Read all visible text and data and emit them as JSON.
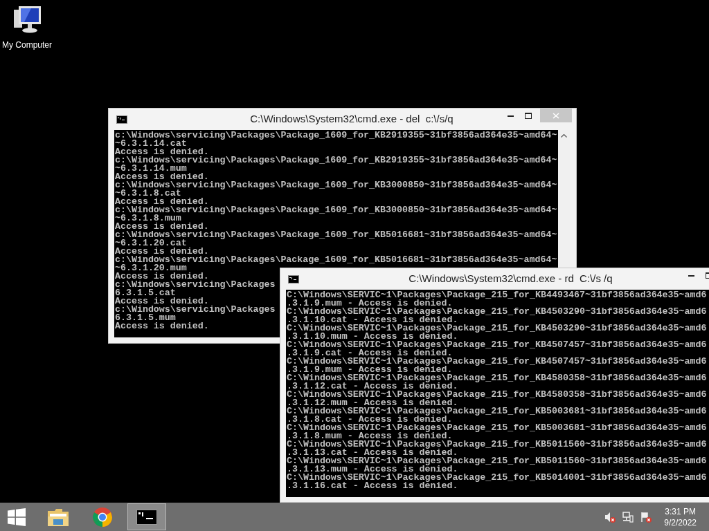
{
  "desktop_icons": [
    {
      "label": "My Computer"
    }
  ],
  "windows": [
    {
      "title": "C:\\Windows\\System32\\cmd.exe - del  c:\\/s/q",
      "controls": [
        {
          "kind": "minimize"
        },
        {
          "kind": "maximize"
        },
        {
          "kind": "close"
        }
      ],
      "scrollbar": true,
      "lines": [
        "c:\\Windows\\servicing\\Packages\\Package_1609_for_KB2919355~31bf3856ad364e35~amd64~",
        "~6.3.1.14.cat",
        "Access is denied.",
        "c:\\Windows\\servicing\\Packages\\Package_1609_for_KB2919355~31bf3856ad364e35~amd64~",
        "~6.3.1.14.mum",
        "Access is denied.",
        "c:\\Windows\\servicing\\Packages\\Package_1609_for_KB3000850~31bf3856ad364e35~amd64~",
        "~6.3.1.8.cat",
        "Access is denied.",
        "c:\\Windows\\servicing\\Packages\\Package_1609_for_KB3000850~31bf3856ad364e35~amd64~",
        "~6.3.1.8.mum",
        "Access is denied.",
        "c:\\Windows\\servicing\\Packages\\Package_1609_for_KB5016681~31bf3856ad364e35~amd64~",
        "~6.3.1.20.cat",
        "Access is denied.",
        "c:\\Windows\\servicing\\Packages\\Package_1609_for_KB5016681~31bf3856ad364e35~amd64~",
        "~6.3.1.20.mum",
        "Access is denied.",
        "c:\\Windows\\servicing\\Packages",
        "6.3.1.5.cat",
        "Access is denied.",
        "c:\\Windows\\servicing\\Packages",
        "6.3.1.5.mum",
        "Access is denied."
      ]
    },
    {
      "title": "C:\\Windows\\System32\\cmd.exe - rd  C:\\/s /q",
      "controls": [
        {
          "kind": "minimize"
        },
        {
          "kind": "maximize"
        }
      ],
      "scrollbar": false,
      "lines": [
        "C:\\Windows\\SERVIC~1\\Packages\\Package_215_for_KB4493467~31bf3856ad364e35~amd6",
        ".3.1.9.mum - Access is denied.",
        "C:\\Windows\\SERVIC~1\\Packages\\Package_215_for_KB4503290~31bf3856ad364e35~amd6",
        ".3.1.10.cat - Access is denied.",
        "C:\\Windows\\SERVIC~1\\Packages\\Package_215_for_KB4503290~31bf3856ad364e35~amd6",
        ".3.1.10.mum - Access is denied.",
        "C:\\Windows\\SERVIC~1\\Packages\\Package_215_for_KB4507457~31bf3856ad364e35~amd6",
        ".3.1.9.cat - Access is denied.",
        "C:\\Windows\\SERVIC~1\\Packages\\Package_215_for_KB4507457~31bf3856ad364e35~amd6",
        ".3.1.9.mum - Access is denied.",
        "C:\\Windows\\SERVIC~1\\Packages\\Package_215_for_KB4580358~31bf3856ad364e35~amd6",
        ".3.1.12.cat - Access is denied.",
        "C:\\Windows\\SERVIC~1\\Packages\\Package_215_for_KB4580358~31bf3856ad364e35~amd6",
        ".3.1.12.mum - Access is denied.",
        "C:\\Windows\\SERVIC~1\\Packages\\Package_215_for_KB5003681~31bf3856ad364e35~amd6",
        ".3.1.8.cat - Access is denied.",
        "C:\\Windows\\SERVIC~1\\Packages\\Package_215_for_KB5003681~31bf3856ad364e35~amd6",
        ".3.1.8.mum - Access is denied.",
        "C:\\Windows\\SERVIC~1\\Packages\\Package_215_for_KB5011560~31bf3856ad364e35~amd6",
        ".3.1.13.cat - Access is denied.",
        "C:\\Windows\\SERVIC~1\\Packages\\Package_215_for_KB5011560~31bf3856ad364e35~amd6",
        ".3.1.13.mum - Access is denied.",
        "C:\\Windows\\SERVIC~1\\Packages\\Package_215_for_KB5014001~31bf3856ad364e35~amd6",
        ".3.1.16.cat - Access is denied."
      ]
    }
  ],
  "taskbar": {
    "items": [
      {
        "kind": "start",
        "selected": false
      },
      {
        "kind": "explorer",
        "selected": false
      },
      {
        "kind": "chrome",
        "selected": false
      },
      {
        "kind": "console",
        "selected": true
      }
    ],
    "tray": [
      {
        "kind": "volume-muted"
      },
      {
        "kind": "network"
      },
      {
        "kind": "flag"
      }
    ],
    "time": "3:31 PM",
    "date": "9/2/2022"
  }
}
